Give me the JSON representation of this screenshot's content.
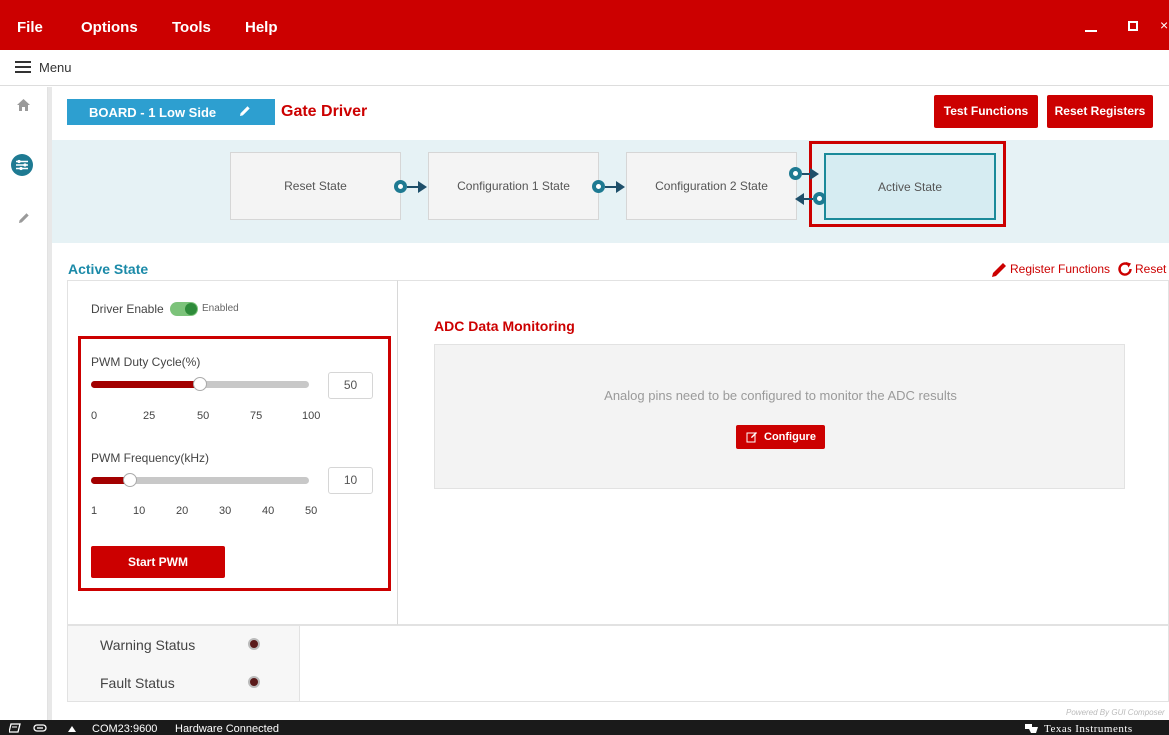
{
  "menubar": {
    "items": [
      "File",
      "Options",
      "Tools",
      "Help"
    ],
    "minimize": "_",
    "close": "×"
  },
  "menu": {
    "label": "Menu"
  },
  "sidebar": {
    "icons": [
      "home-icon",
      "sliders-icon",
      "pencil-icon"
    ]
  },
  "header": {
    "board_label": "BOARD - 1 Low Side",
    "title": "Gate Driver",
    "test_functions": "Test Functions",
    "reset_registers": "Reset Registers"
  },
  "states": [
    {
      "label": "Reset State"
    },
    {
      "label": "Configuration 1 State"
    },
    {
      "label": "Configuration 2 State"
    },
    {
      "label": "Active State"
    }
  ],
  "active_section": {
    "title": "Active State",
    "register_functions": "Register Functions",
    "reset": "Reset"
  },
  "driver": {
    "label": "Driver Enable",
    "toggle_text": "Enabled",
    "enabled": true
  },
  "pwm_duty": {
    "label": "PWM Duty Cycle(%)",
    "value": "50",
    "fraction": 0.5,
    "ticks": [
      "0",
      "25",
      "50",
      "75",
      "100"
    ]
  },
  "pwm_freq": {
    "label": "PWM Frequency(kHz)",
    "value": "10",
    "fraction": 0.18,
    "ticks": [
      "1",
      "10",
      "20",
      "30",
      "40",
      "50"
    ]
  },
  "start_pwm": "Start PWM",
  "adc": {
    "title": "ADC Data Monitoring",
    "message": "Analog pins need to be configured to monitor the ADC results",
    "configure": "Configure"
  },
  "status": {
    "warning": "Warning Status",
    "fault": "Fault Status"
  },
  "footer": {
    "powered": "Powered By GUI Composer",
    "port": "COM23:9600",
    "connection": "Hardware Connected",
    "brand": "Texas Instruments"
  },
  "colors": {
    "accent_red": "#cc0000",
    "teal": "#1b8aa8",
    "board_blue": "#2d9fd0"
  }
}
